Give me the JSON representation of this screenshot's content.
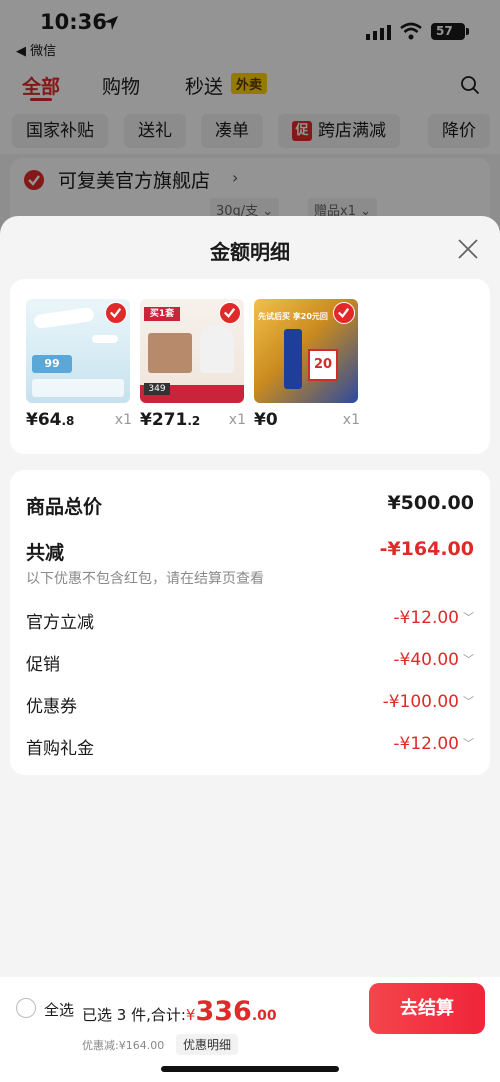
{
  "status_bar": {
    "time": "10:36",
    "back_app": "◀ 微信",
    "battery": "57"
  },
  "tabs": [
    {
      "label": "全部"
    },
    {
      "label": "购物"
    },
    {
      "label": "秒送"
    }
  ],
  "tab_badge": "外卖",
  "filters": [
    {
      "label": "国家补贴"
    },
    {
      "label": "送礼"
    },
    {
      "label": "凑单"
    },
    {
      "label": "跨店满减",
      "badge": "促"
    },
    {
      "label": "降价"
    }
  ],
  "store": {
    "name": "可复美官方旗舰店",
    "arrow": "›",
    "spec": "30g/支 ⌄",
    "gift": "赠品x1 ⌄"
  },
  "sheet": {
    "title": "金额明细",
    "products": [
      {
        "price_int": "¥64",
        "price_dec": ".8",
        "qty": "x1",
        "thumb_text": "99"
      },
      {
        "price_int": "¥271",
        "price_dec": ".2",
        "qty": "x1",
        "thumb_text": "买1套",
        "thumb_sub": "349"
      },
      {
        "price_int": "¥0",
        "price_dec": "",
        "qty": "x1",
        "thumb_text": "先试后买 享20元回",
        "thumb_sub": "20"
      }
    ],
    "summary": {
      "total_label": "商品总价",
      "total_value": "¥500.00",
      "discount_label": "共减",
      "discount_value": "-¥164.00",
      "note": "以下优惠不包含红包，请在结算页查看",
      "items": [
        {
          "label": "官方立减",
          "value": "-¥12.00"
        },
        {
          "label": "促销",
          "value": "-¥40.00"
        },
        {
          "label": "优惠券",
          "value": "-¥100.00"
        },
        {
          "label": "首购礼金",
          "value": "-¥12.00"
        }
      ]
    }
  },
  "bottom": {
    "select_all": "全选",
    "selected_info": "已选 3 件,合计:",
    "currency": "¥",
    "total_int": "336",
    "total_dec": ".00",
    "discount_info": "优惠减:¥164.00",
    "detail_label": "优惠明细",
    "checkout_label": "去结算"
  },
  "colors": {
    "accent": "#e02a2a",
    "badge_yellow": "#ffd400"
  }
}
